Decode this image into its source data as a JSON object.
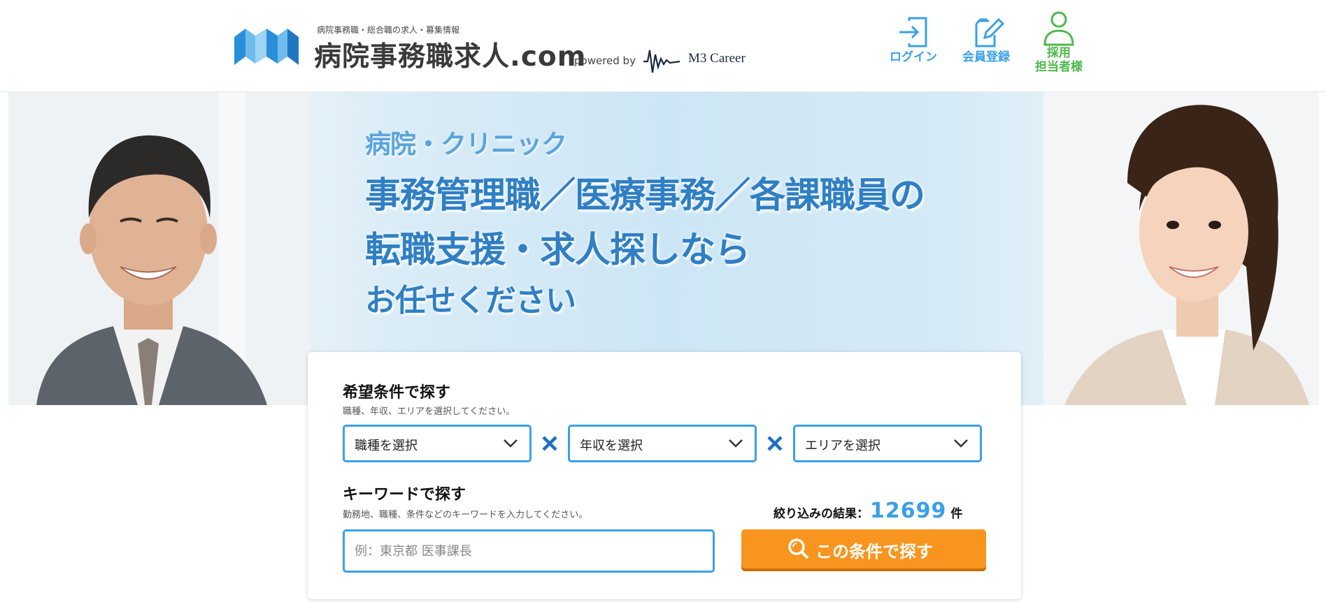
{
  "header": {
    "tagline": "病院事務職・総合職の求人・募集情報",
    "site_title": "病院事務職求人.com",
    "powered_by": "powered by",
    "partner": "M3 Career",
    "nav": {
      "login_label": "ログイン",
      "register_label": "会員登録",
      "recruiter_label_line1": "採用",
      "recruiter_label_line2": "担当者様"
    },
    "colors": {
      "nav_blue": "#3aa0e6",
      "nav_green": "#4cb84a"
    }
  },
  "hero": {
    "subheading": "病院・クリニック",
    "line1": "事務管理職／医療事務／各課職員の",
    "line2": "転職支援・求人探しなら",
    "line3": "お任せください"
  },
  "search": {
    "conditions_title": "希望条件で探す",
    "conditions_help": "職種、年収、エリアを選択してください。",
    "select_job": "職種を選択",
    "select_salary": "年収を選択",
    "select_area": "エリアを選択",
    "keyword_title": "キーワードで探す",
    "keyword_help": "勤務地、職種、条件などのキーワードを入力してください。",
    "keyword_placeholder": "例：東京都 医事課長",
    "result_label": "絞り込みの結果：",
    "result_count": "12699",
    "result_unit": "件",
    "button_label": "この条件で探す",
    "colors": {
      "accent": "#3aa0e6",
      "button": "#f7951e"
    }
  },
  "icons": [
    "logo-mark-icon",
    "login-icon",
    "register-icon",
    "recruiter-icon",
    "chevron-down-icon",
    "times-icon",
    "search-icon"
  ]
}
